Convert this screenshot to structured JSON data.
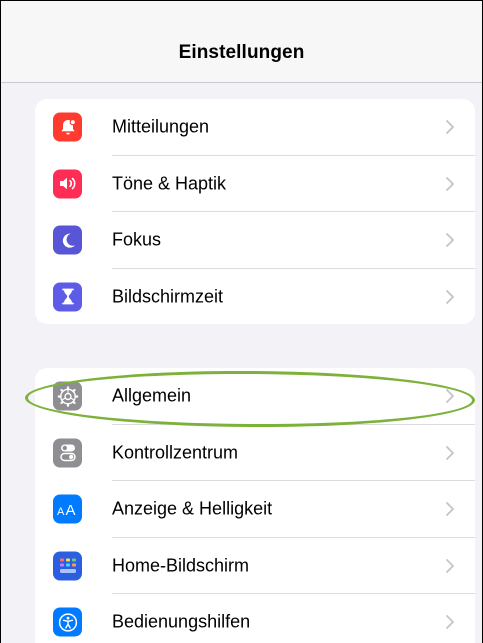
{
  "header": {
    "title": "Einstellungen"
  },
  "groups": [
    {
      "items": [
        {
          "label": "Mitteilungen",
          "icon": "notifications-bell-icon",
          "color": "#ff3b30"
        },
        {
          "label": "Töne & Haptik",
          "icon": "speaker-sound-icon",
          "color": "#ff2d55"
        },
        {
          "label": "Fokus",
          "icon": "moon-icon",
          "color": "#5856d6"
        },
        {
          "label": "Bildschirmzeit",
          "icon": "hourglass-icon",
          "color": "#5e5ce6"
        }
      ]
    },
    {
      "items": [
        {
          "label": "Allgemein",
          "icon": "gear-icon",
          "color": "#8e8e93"
        },
        {
          "label": "Kontrollzentrum",
          "icon": "toggle-switches-icon",
          "color": "#8e8e93"
        },
        {
          "label": "Anzeige & Helligkeit",
          "icon": "text-size-aa-icon",
          "color": "#007aff"
        },
        {
          "label": "Home-Bildschirm",
          "icon": "app-grid-icon",
          "color": "#2c5fe0"
        },
        {
          "label": "Bedienungshilfen",
          "icon": "accessibility-person-icon",
          "color": "#007aff"
        }
      ]
    }
  ],
  "annotation": {
    "highlighted_item": "Allgemein",
    "color": "#7db23a"
  }
}
